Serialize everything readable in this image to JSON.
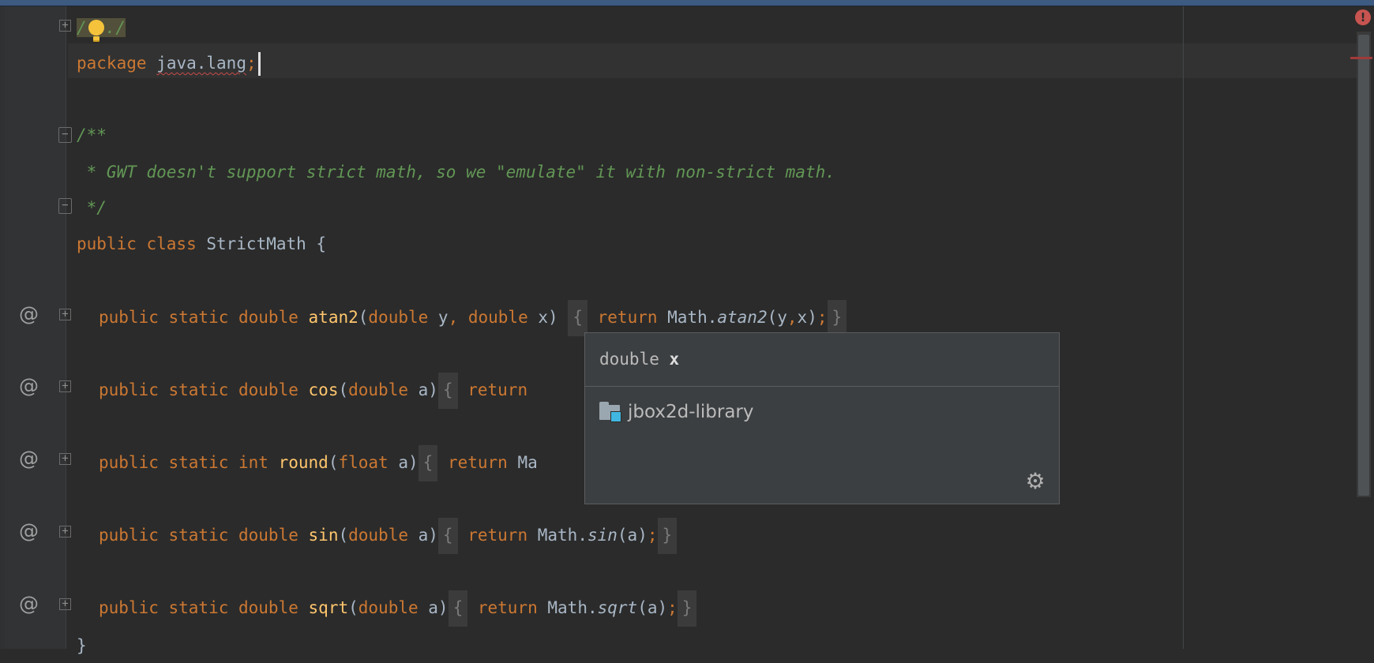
{
  "editor": {
    "lines": [
      {
        "id": "comment-collapsed",
        "parts": [
          "/",
          "./"
        ]
      },
      {
        "id": "package",
        "parts": [
          "package",
          " ",
          "java.lang",
          ";"
        ]
      },
      {
        "id": "javadoc-open",
        "text": "/**"
      },
      {
        "id": "javadoc-body",
        "text": " * GWT doesn't support strict math, so we \"emulate\" it with non-strict math."
      },
      {
        "id": "javadoc-close",
        "text": " */"
      },
      {
        "id": "class-decl",
        "parts": [
          "public class",
          " StrictMath {"
        ]
      },
      {
        "id": "atan2",
        "parts": [
          "public static double",
          "atan2",
          "(",
          "double",
          " y",
          ",",
          " double",
          " x)",
          "{",
          "return",
          "Math.",
          "atan2",
          "(y",
          ",",
          "x)",
          ";",
          "}"
        ]
      },
      {
        "id": "cos",
        "parts": [
          "public static double",
          "cos",
          "(",
          "double",
          " a)",
          "{",
          "return"
        ]
      },
      {
        "id": "round",
        "parts": [
          "public static int",
          "round",
          "(",
          "float",
          " a)",
          "{",
          "return",
          "Ma"
        ]
      },
      {
        "id": "sin",
        "parts": [
          "public static double",
          "sin",
          "(",
          "double",
          " a)",
          "{",
          "return",
          "Math.",
          "sin",
          "(a)",
          ";",
          "}"
        ]
      },
      {
        "id": "sqrt",
        "parts": [
          "public static double",
          "sqrt",
          "(",
          "double",
          " a)",
          "{",
          "return",
          "Math.",
          "sqrt",
          "(a)",
          ";",
          "}"
        ]
      },
      {
        "id": "class-close",
        "text": "}"
      }
    ]
  },
  "gutter": {
    "override_marker": "@"
  },
  "popup": {
    "type_text": "double",
    "param_name": "x",
    "library": "jbox2d-library"
  },
  "icons": {
    "bulb": "lightbulb-icon",
    "gear": "gear-icon",
    "error": "error-icon",
    "folder": "folder-library-icon"
  },
  "colors": {
    "background": "#2b2b2b",
    "keyword": "#cc7832",
    "function": "#ffc66d",
    "comment": "#629755",
    "text": "#a9b7c6",
    "error": "#c75450"
  }
}
